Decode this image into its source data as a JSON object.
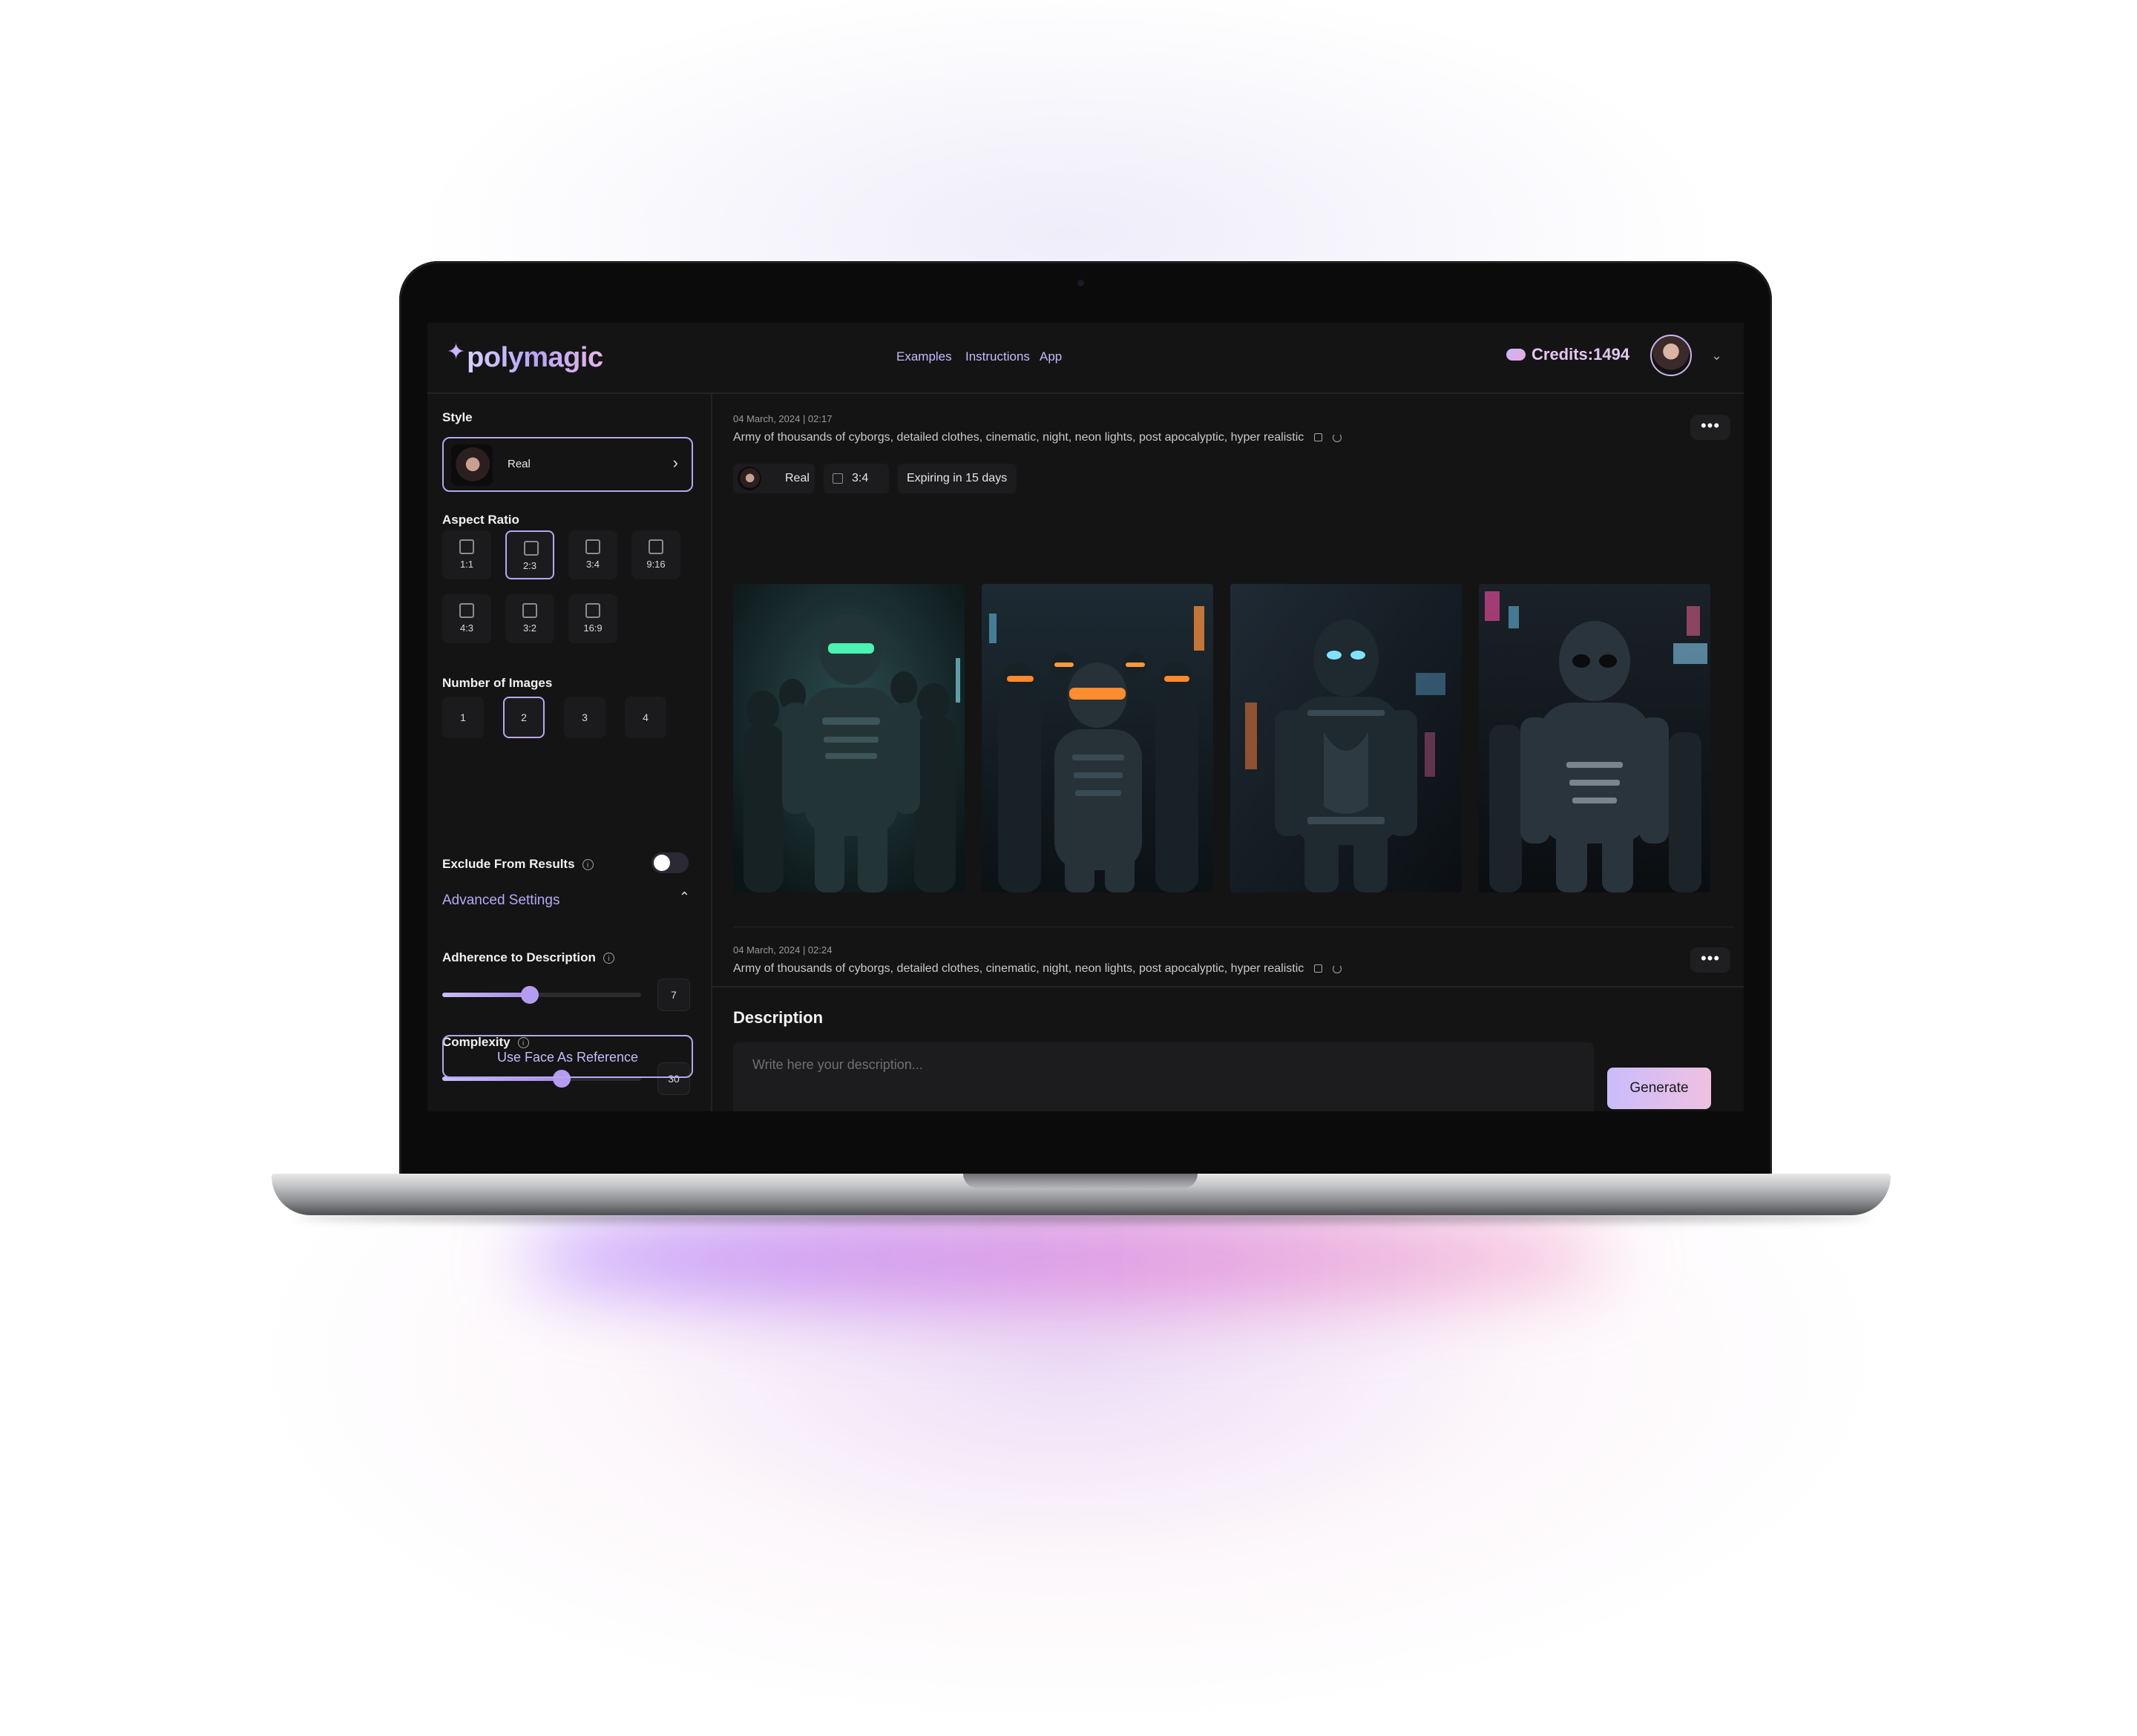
{
  "app": {
    "logo_text": "polymagic",
    "nav": [
      "Examples",
      "Instructions",
      "App"
    ],
    "credits": "Credits:1494"
  },
  "sidebar": {
    "style_label": "Style",
    "style_value": "Real",
    "aspect_label": "Aspect Ratio",
    "aspect_ratios": [
      "1:1",
      "2:3",
      "3:4",
      "9:16",
      "4:3",
      "3:2",
      "16:9"
    ],
    "aspect_selected": "2:3",
    "images_label": "Number of Images",
    "image_counts": [
      "1",
      "2",
      "3",
      "4"
    ],
    "images_selected": "2",
    "exclude_label": "Exclude From Results",
    "exclude_on": false,
    "advanced_label": "Advanced Settings",
    "adherence_label": "Adherence to Description",
    "adherence_value": "7",
    "adherence_fraction": 0.44,
    "complexity_label": "Complexity",
    "complexity_value": "30",
    "complexity_fraction": 0.6,
    "face_button": "Use Face As Reference"
  },
  "generations": [
    {
      "timestamp": "04 March, 2024 | 02:17",
      "prompt": "Army of thousands of cyborgs, detailed clothes, cinematic, night, neon lights, post apocalyptic, hyper realistic",
      "tags": {
        "style": "Real",
        "ratio": "3:4",
        "expiry": "Expiring in 15 days"
      },
      "images": 4
    },
    {
      "timestamp": "04 March, 2024 | 02:24",
      "prompt": "Army of thousands of cyborgs, detailed clothes, cinematic, night, neon lights, post apocalyptic, hyper realistic"
    }
  ],
  "composer": {
    "title": "Description",
    "placeholder": "Write here your description...",
    "generate_label": "Generate"
  },
  "colors": {
    "accent": "#b9a8f2",
    "background": "#141414",
    "generate_gradient_start": "#c9bcfb",
    "generate_gradient_end": "#efc1e0"
  }
}
